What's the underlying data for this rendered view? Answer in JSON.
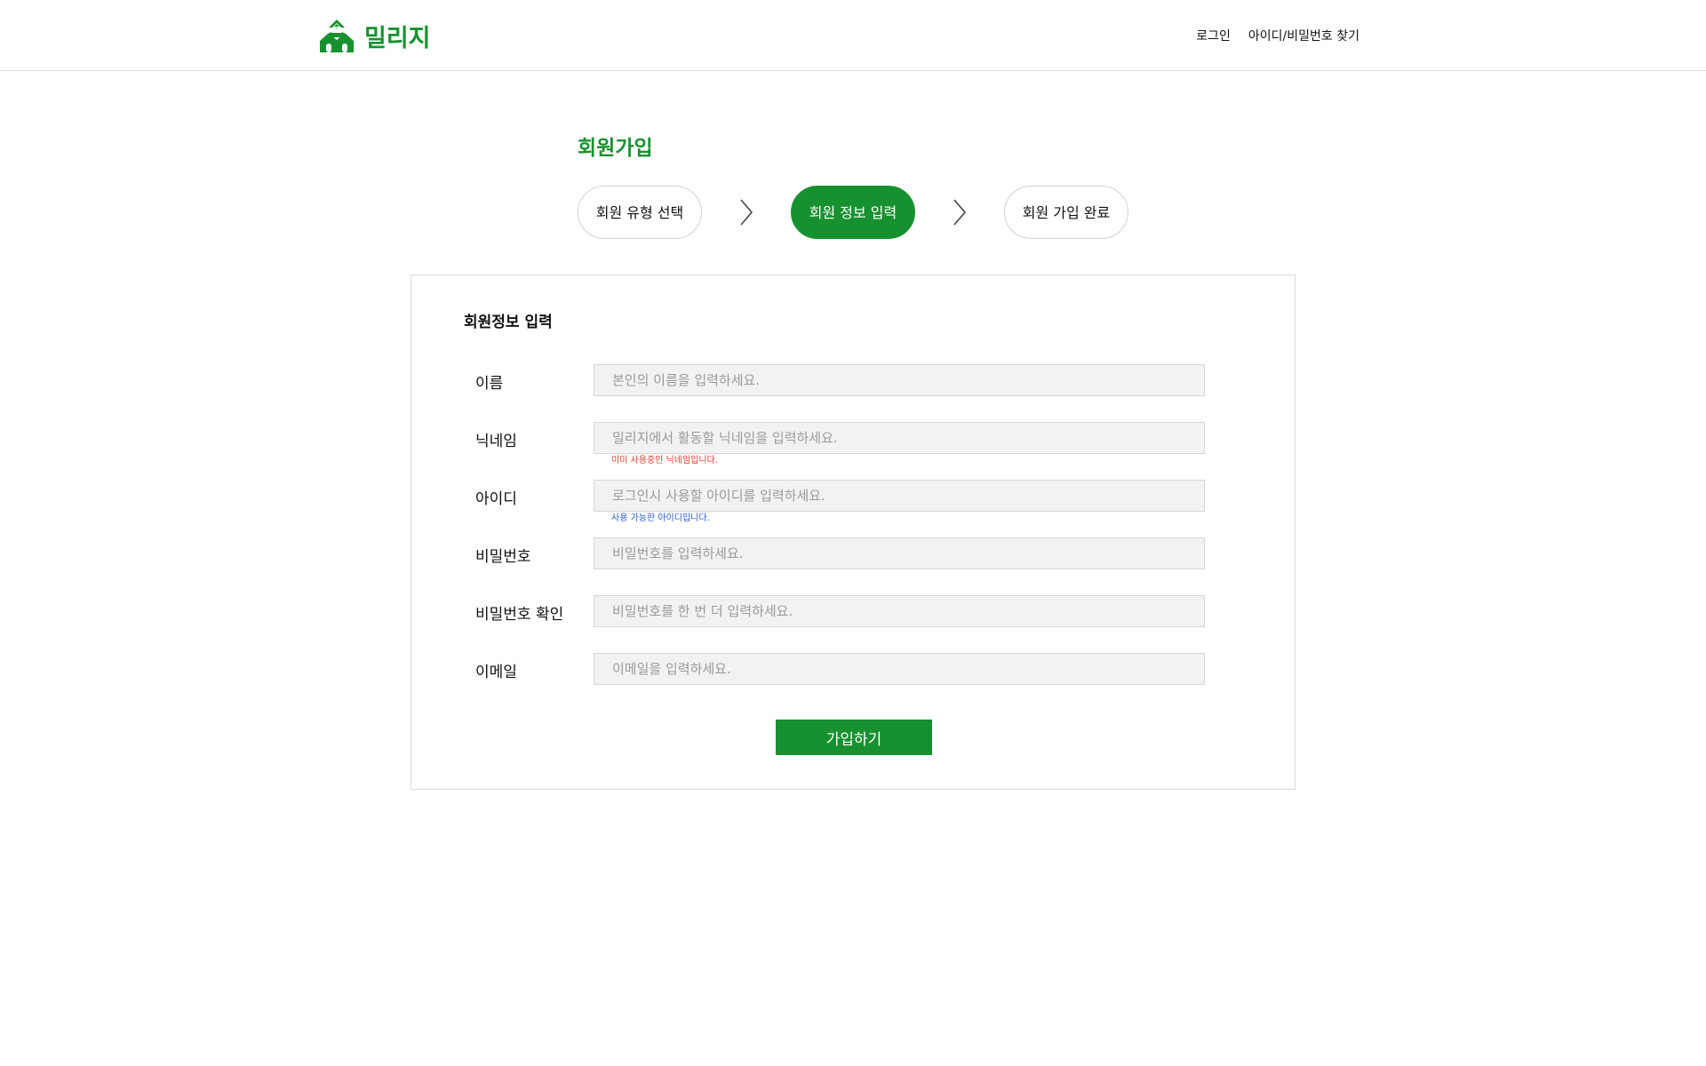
{
  "header": {
    "logo_text": "밀리지",
    "brand_color": "#17912f",
    "nav": {
      "login": "로그인",
      "find_account": "아이디/비밀번호 찾기"
    }
  },
  "page": {
    "title": "회원가입"
  },
  "steps": [
    {
      "label": "회원 유형 선택",
      "active": false
    },
    {
      "label": "회원 정보 입력",
      "active": true
    },
    {
      "label": "회원 가입 완료",
      "active": false
    }
  ],
  "form": {
    "title": "회원정보 입력",
    "fields": [
      {
        "label": "이름",
        "placeholder": "본인의 이름을 입력하세요.",
        "value": "",
        "message": ""
      },
      {
        "label": "닉네임",
        "placeholder": "밀리지에서 활동할 닉네임을 입력하세요.",
        "value": "",
        "message": "이미 사용중인 닉네임입니다."
      },
      {
        "label": "아이디",
        "placeholder": "로그인시 사용할 아이디를 입력하세요.",
        "value": "",
        "message": "사용 가능한 아이디입니다."
      },
      {
        "label": "비밀번호",
        "placeholder": "비밀번호를 입력하세요.",
        "value": "",
        "message": ""
      },
      {
        "label": "비밀번호 확인",
        "placeholder": "비밀번호를 한 번 더 입력하세요.",
        "value": "",
        "message": ""
      },
      {
        "label": "이메일",
        "placeholder": "이메일을 입력하세요.",
        "value": "",
        "message": ""
      }
    ],
    "submit_label": "가입하기"
  },
  "colors": {
    "accent": "#17912f",
    "error": "#e03b2f",
    "success": "#2a5bd7",
    "input_bg": "#f2f2f2"
  },
  "icons": {
    "logo": "houses-logo-icon",
    "step_arrow": "chevron-right-icon"
  }
}
